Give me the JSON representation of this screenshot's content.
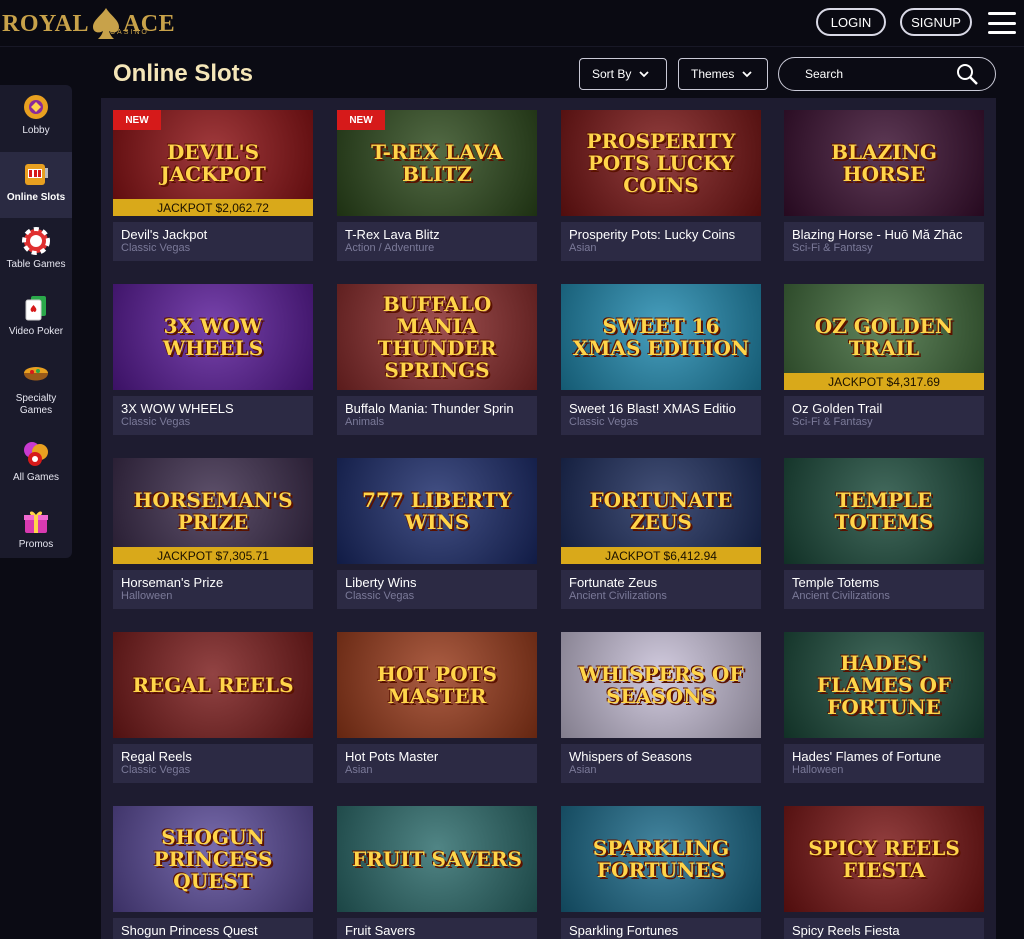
{
  "brand": {
    "word_left": "ROYAL",
    "word_right": "ACE",
    "sub": "CASINO"
  },
  "header": {
    "login": "LOGIN",
    "signup": "SIGNUP"
  },
  "sidebar": {
    "items": [
      {
        "label": "Lobby",
        "icon": "lobby-icon"
      },
      {
        "label": "Online Slots",
        "icon": "slot-machine-icon"
      },
      {
        "label": "Table Games",
        "icon": "poker-chip-icon"
      },
      {
        "label": "Video Poker",
        "icon": "playing-cards-icon"
      },
      {
        "label": "Specialty Games",
        "icon": "specialty-bowl-icon"
      },
      {
        "label": "All Games",
        "icon": "all-games-icon"
      },
      {
        "label": "Promos",
        "icon": "gift-icon"
      }
    ],
    "active_index": 1
  },
  "page": {
    "title": "Online Slots",
    "sort_label": "Sort By",
    "themes_label": "Themes",
    "search_placeholder": "Search"
  },
  "games": [
    {
      "name": "Devil's Jackpot",
      "category": "Classic Vegas",
      "thumb_text": "DEVIL'S JACKPOT",
      "new_badge": "NEW",
      "jackpot": "JACKPOT $2,062.72",
      "bg": "#8c0f12"
    },
    {
      "name": "T-Rex Lava Blitz",
      "category": "Action / Adventure",
      "thumb_text": "T-REX LAVA BLITZ",
      "new_badge": "NEW",
      "bg": "#2d4a1c"
    },
    {
      "name": "Prosperity Pots: Lucky Coins",
      "category": "Asian",
      "thumb_text": "PROSPERITY POTS LUCKY COINS",
      "bg": "#7a1414"
    },
    {
      "name": "Blazing Horse - Huō Mă Zhāc",
      "category": "Sci-Fi & Fantasy",
      "thumb_text": "BLAZING HORSE",
      "bg": "#3a0e30"
    },
    {
      "name": "3X WOW WHEELS",
      "category": "Classic Vegas",
      "thumb_text": "3X WOW WHEELS",
      "bg": "#5a1a9a"
    },
    {
      "name": "Buffalo Mania: Thunder Sprin",
      "category": "Animals",
      "thumb_text": "BUFFALO MANIA THUNDER SPRINGS",
      "bg": "#8a2a2a"
    },
    {
      "name": "Sweet 16 Blast! XMAS Editio",
      "category": "Classic Vegas",
      "thumb_text": "SWEET 16 XMAS EDITION",
      "bg": "#1f8ab0"
    },
    {
      "name": "Oz Golden Trail",
      "category": "Sci-Fi & Fantasy",
      "thumb_text": "OZ GOLDEN TRAIL",
      "jackpot": "JACKPOT $4,317.69",
      "bg": "#3f6a3a"
    },
    {
      "name": "Horseman's Prize",
      "category": "Halloween",
      "thumb_text": "HORSEMAN'S PRIZE",
      "jackpot": "JACKPOT $7,305.71",
      "bg": "#3a2a4a"
    },
    {
      "name": "Liberty Wins",
      "category": "Classic Vegas",
      "thumb_text": "777 LIBERTY WINS",
      "bg": "#1a2a6a"
    },
    {
      "name": "Fortunate Zeus",
      "category": "Ancient Civilizations",
      "thumb_text": "FORTUNATE ZEUS",
      "jackpot": "JACKPOT $6,412.94",
      "bg": "#1a2a5a"
    },
    {
      "name": "Temple Totems",
      "category": "Ancient Civilizations",
      "thumb_text": "TEMPLE TOTEMS",
      "bg": "#1a4a3a"
    },
    {
      "name": "Regal Reels",
      "category": "Classic Vegas",
      "thumb_text": "REGAL REELS",
      "bg": "#7a1a1a"
    },
    {
      "name": "Hot Pots Master",
      "category": "Asian",
      "thumb_text": "HOT POTS MASTER",
      "bg": "#9a3a1a"
    },
    {
      "name": "Whispers of Seasons",
      "category": "Asian",
      "thumb_text": "WHISPERS OF SEASONS",
      "bg": "#c8c0d8"
    },
    {
      "name": "Hades' Flames of Fortune",
      "category": "Halloween",
      "thumb_text": "HADES' FLAMES OF FORTUNE",
      "bg": "#1a4a3a"
    },
    {
      "name": "Shogun Princess Quest",
      "category": "",
      "thumb_text": "SHOGUN PRINCESS QUEST",
      "bg": "#5a4a9a"
    },
    {
      "name": "Fruit Savers",
      "category": "",
      "thumb_text": "FRUIT SAVERS",
      "bg": "#2a6a6a"
    },
    {
      "name": "Sparkling Fortunes",
      "category": "",
      "thumb_text": "SPARKLING FORTUNES",
      "bg": "#1a6a8a"
    },
    {
      "name": "Spicy Reels Fiesta",
      "category": "",
      "thumb_text": "SPICY REELS FIESTA",
      "bg": "#7a1414"
    }
  ]
}
